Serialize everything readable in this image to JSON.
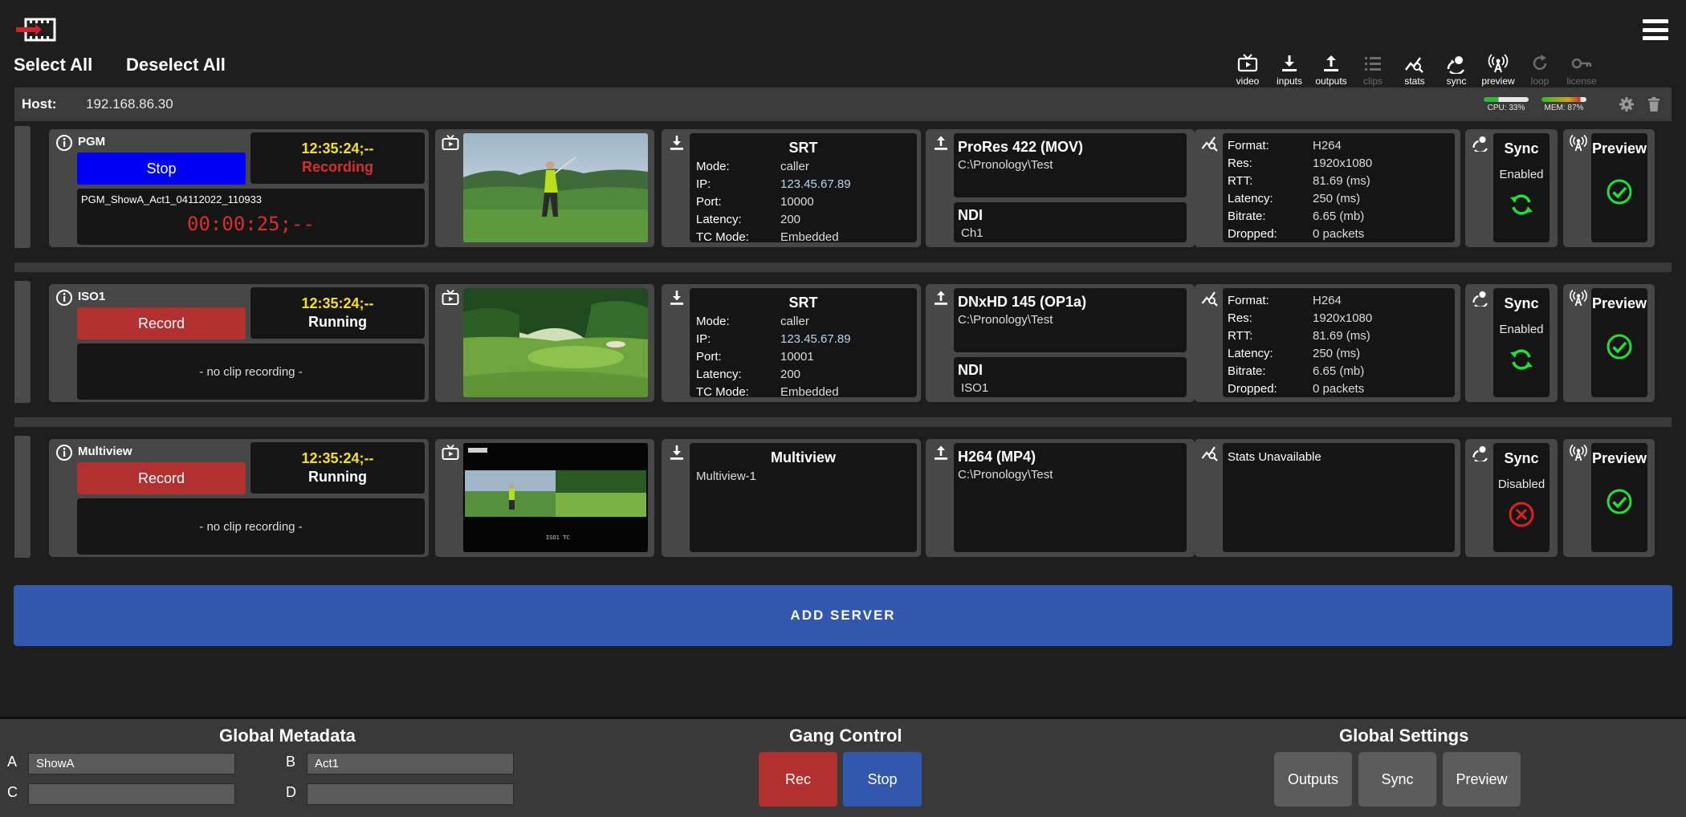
{
  "header": {
    "select_all": "Select All",
    "deselect_all": "Deselect All",
    "toolbar": [
      {
        "label": "video",
        "icon": "tv-icon",
        "enabled": true
      },
      {
        "label": "inputs",
        "icon": "download-icon",
        "enabled": true
      },
      {
        "label": "outputs",
        "icon": "upload-icon",
        "enabled": true
      },
      {
        "label": "clips",
        "icon": "list-icon",
        "enabled": false
      },
      {
        "label": "stats",
        "icon": "stats-icon",
        "enabled": true
      },
      {
        "label": "sync",
        "icon": "sync-icon",
        "enabled": true
      },
      {
        "label": "preview",
        "icon": "broadcast-icon",
        "enabled": true
      },
      {
        "label": "loop",
        "icon": "loop-icon",
        "enabled": false
      },
      {
        "label": "license",
        "icon": "key-icon",
        "enabled": false
      }
    ]
  },
  "host": {
    "label": "Host:",
    "ip": "192.168.86.30",
    "cpu_label": "CPU: 33%",
    "cpu_percent": 33,
    "mem_label": "MEM: 87%",
    "mem_percent": 87
  },
  "channels": [
    {
      "name": "PGM",
      "action_label": "Stop",
      "timecode": "12:35:24;--",
      "status": "Recording",
      "clip_name": "PGM_ShowA_Act1_04112022_110933",
      "clip_duration": "00:00:25;--",
      "no_clip": "",
      "input": {
        "title": "SRT",
        "fields": [
          {
            "k": "Mode:",
            "v": "caller"
          },
          {
            "k": "IP:",
            "v": "123.45.67.89"
          },
          {
            "k": "Port:",
            "v": "10000"
          },
          {
            "k": "Latency:",
            "v": "200"
          },
          {
            "k": "TC Mode:",
            "v": "Embedded"
          }
        ]
      },
      "outputs": [
        {
          "title": "ProRes 422 (MOV)",
          "detail": "C:\\Pronology\\Test"
        },
        {
          "title": "NDI",
          "detail": "Ch1"
        }
      ],
      "stats_unavailable": "",
      "stats": [
        {
          "k": "Format:",
          "v": "H264"
        },
        {
          "k": "Res:",
          "v": "1920x1080"
        },
        {
          "k": "RTT:",
          "v": "81.69 (ms)"
        },
        {
          "k": "Latency:",
          "v": "250 (ms)"
        },
        {
          "k": "Bitrate:",
          "v": "6.65 (mb)"
        },
        {
          "k": "Dropped:",
          "v": "0 packets"
        }
      ],
      "sync": {
        "title": "Sync",
        "state": "Enabled"
      },
      "preview": {
        "title": "Preview"
      }
    },
    {
      "name": "ISO1",
      "action_label": "Record",
      "timecode": "12:35:24;--",
      "status": "Running",
      "clip_name": "",
      "clip_duration": "",
      "no_clip": "- no clip recording -",
      "input": {
        "title": "SRT",
        "fields": [
          {
            "k": "Mode:",
            "v": "caller"
          },
          {
            "k": "IP:",
            "v": "123.45.67.89"
          },
          {
            "k": "Port:",
            "v": "10001"
          },
          {
            "k": "Latency:",
            "v": "200"
          },
          {
            "k": "TC Mode:",
            "v": "Embedded"
          }
        ]
      },
      "outputs": [
        {
          "title": "DNxHD 145 (OP1a)",
          "detail": "C:\\Pronology\\Test"
        },
        {
          "title": "NDI",
          "detail": "ISO1"
        }
      ],
      "stats_unavailable": "",
      "stats": [
        {
          "k": "Format:",
          "v": "H264"
        },
        {
          "k": "Res:",
          "v": "1920x1080"
        },
        {
          "k": "RTT:",
          "v": "81.69 (ms)"
        },
        {
          "k": "Latency:",
          "v": "250 (ms)"
        },
        {
          "k": "Bitrate:",
          "v": "6.65 (mb)"
        },
        {
          "k": "Dropped:",
          "v": "0 packets"
        }
      ],
      "sync": {
        "title": "Sync",
        "state": "Enabled"
      },
      "preview": {
        "title": "Preview"
      }
    },
    {
      "name": "Multiview",
      "action_label": "Record",
      "timecode": "12:35:24;--",
      "status": "Running",
      "clip_name": "",
      "clip_duration": "",
      "no_clip": "- no clip recording -",
      "input": {
        "title": "Multiview",
        "fields": [
          {
            "k": "Multiview-1",
            "v": ""
          }
        ]
      },
      "outputs": [
        {
          "title": "H264 (MP4)",
          "detail": "C:\\Pronology\\Test"
        }
      ],
      "stats_unavailable": "Stats Unavailable",
      "stats": [],
      "sync": {
        "title": "Sync",
        "state": "Disabled"
      },
      "preview": {
        "title": "Preview"
      }
    }
  ],
  "add_server": "ADD SERVER",
  "footer": {
    "metadata": {
      "title": "Global Metadata",
      "fields": [
        {
          "label": "A",
          "value": "ShowA"
        },
        {
          "label": "B",
          "value": "Act1"
        },
        {
          "label": "C",
          "value": ""
        },
        {
          "label": "D",
          "value": ""
        }
      ]
    },
    "gang": {
      "title": "Gang Control",
      "rec": "Rec",
      "stop": "Stop"
    },
    "settings": {
      "title": "Global Settings",
      "outputs": "Outputs",
      "sync": "Sync",
      "preview": "Preview"
    }
  },
  "colors": {
    "stop_blue": "#0000f5",
    "record_red": "#b33030",
    "timecode_yellow": "#f5e11e",
    "add_server_blue": "#3158ad",
    "ok_green": "#22e03a",
    "error_red": "#e02020"
  }
}
